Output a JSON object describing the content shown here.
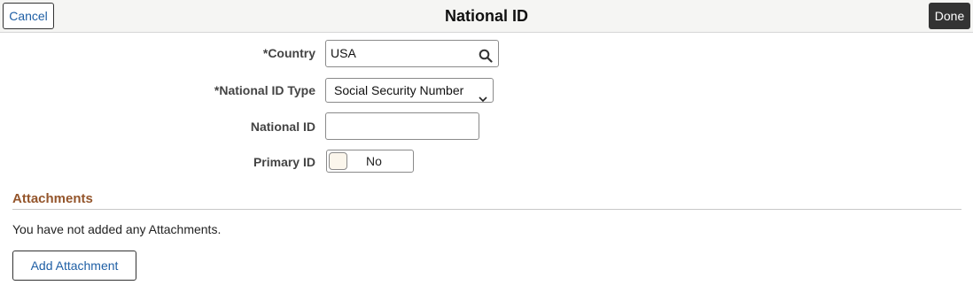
{
  "header": {
    "cancel_label": "Cancel",
    "title": "National ID",
    "done_label": "Done"
  },
  "form": {
    "country": {
      "label": "*Country",
      "value": "USA",
      "icon": "search-icon"
    },
    "national_id_type": {
      "label": "*National ID Type",
      "selected": "Social Security Number",
      "icon": "chevron-down-icon"
    },
    "national_id": {
      "label": "National ID",
      "value": ""
    },
    "primary_id": {
      "label": "Primary ID",
      "state": "No"
    }
  },
  "attachments": {
    "title": "Attachments",
    "empty_message": "You have not added any Attachments.",
    "add_label": "Add Attachment"
  },
  "colors": {
    "link_blue": "#1f5fa5",
    "section_title": "#94552b",
    "done_bg": "#333333",
    "header_bg": "#f5f5f3"
  }
}
